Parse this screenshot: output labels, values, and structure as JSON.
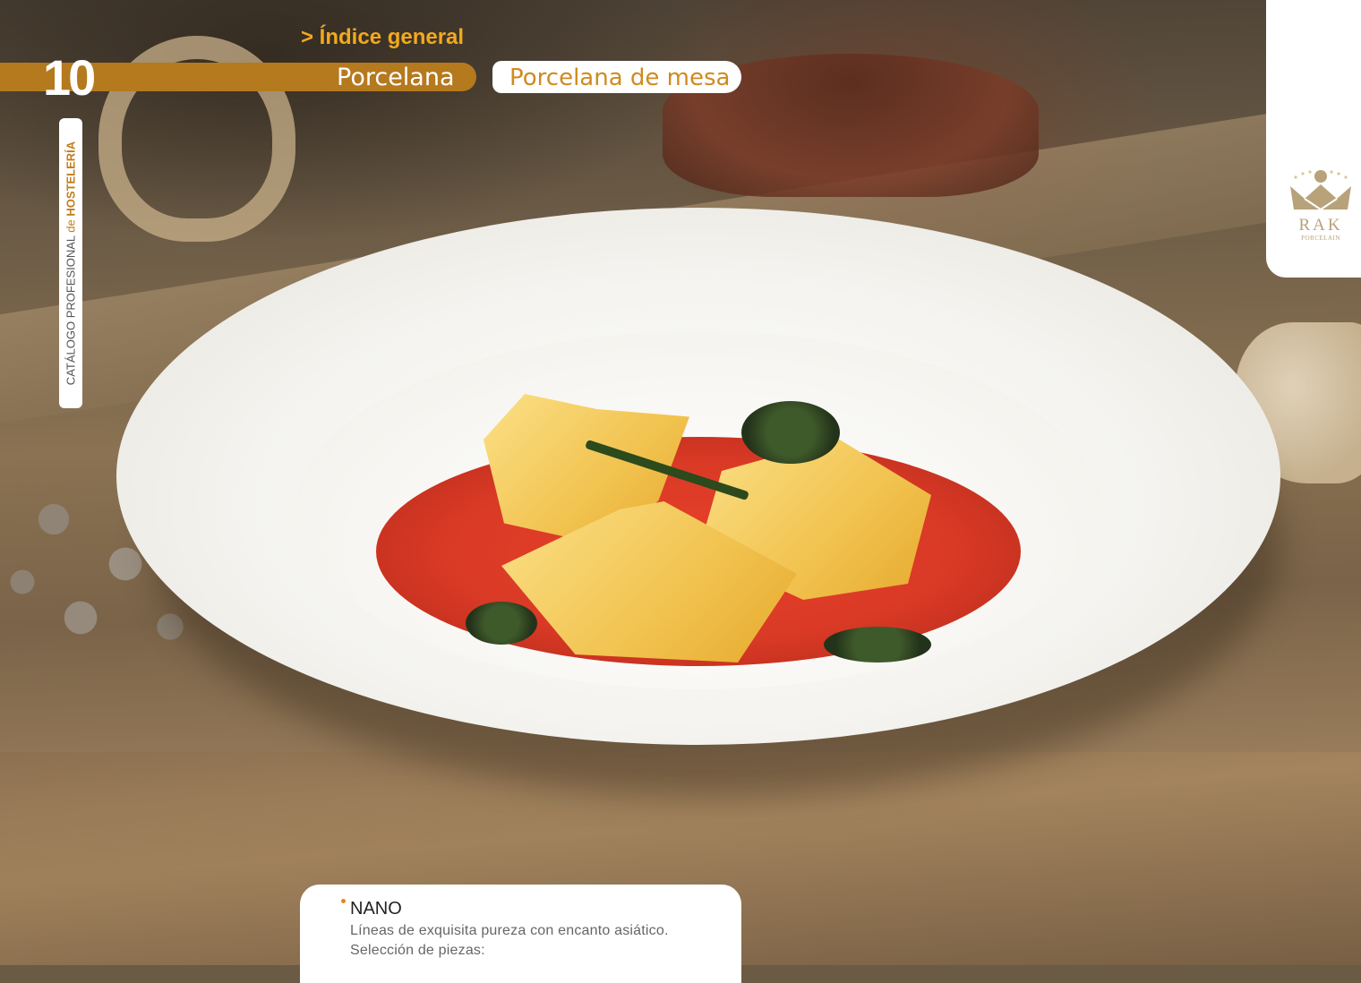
{
  "header": {
    "index_link": "> Índice general",
    "chapter_number": "10",
    "section": "Porcelana",
    "subsection": "Porcelana de mesa"
  },
  "side_tab": {
    "prefix": "CATÁLOGO PROFESIONAL",
    "connector": "de",
    "highlight": "HOSTELERÍA"
  },
  "brand": {
    "name": "RAK",
    "tagline": "PORCELAIN",
    "logo_icon": "crown-icon"
  },
  "product": {
    "name": "NANO",
    "description_line1": "Líneas de exquisita pureza con encanto asiático.",
    "description_line2": "Selección de piezas:"
  },
  "colors": {
    "accent": "#b5791e",
    "link": "#f2a91e",
    "subsection_text": "#d08a1f",
    "logo": "#b8a27a"
  }
}
